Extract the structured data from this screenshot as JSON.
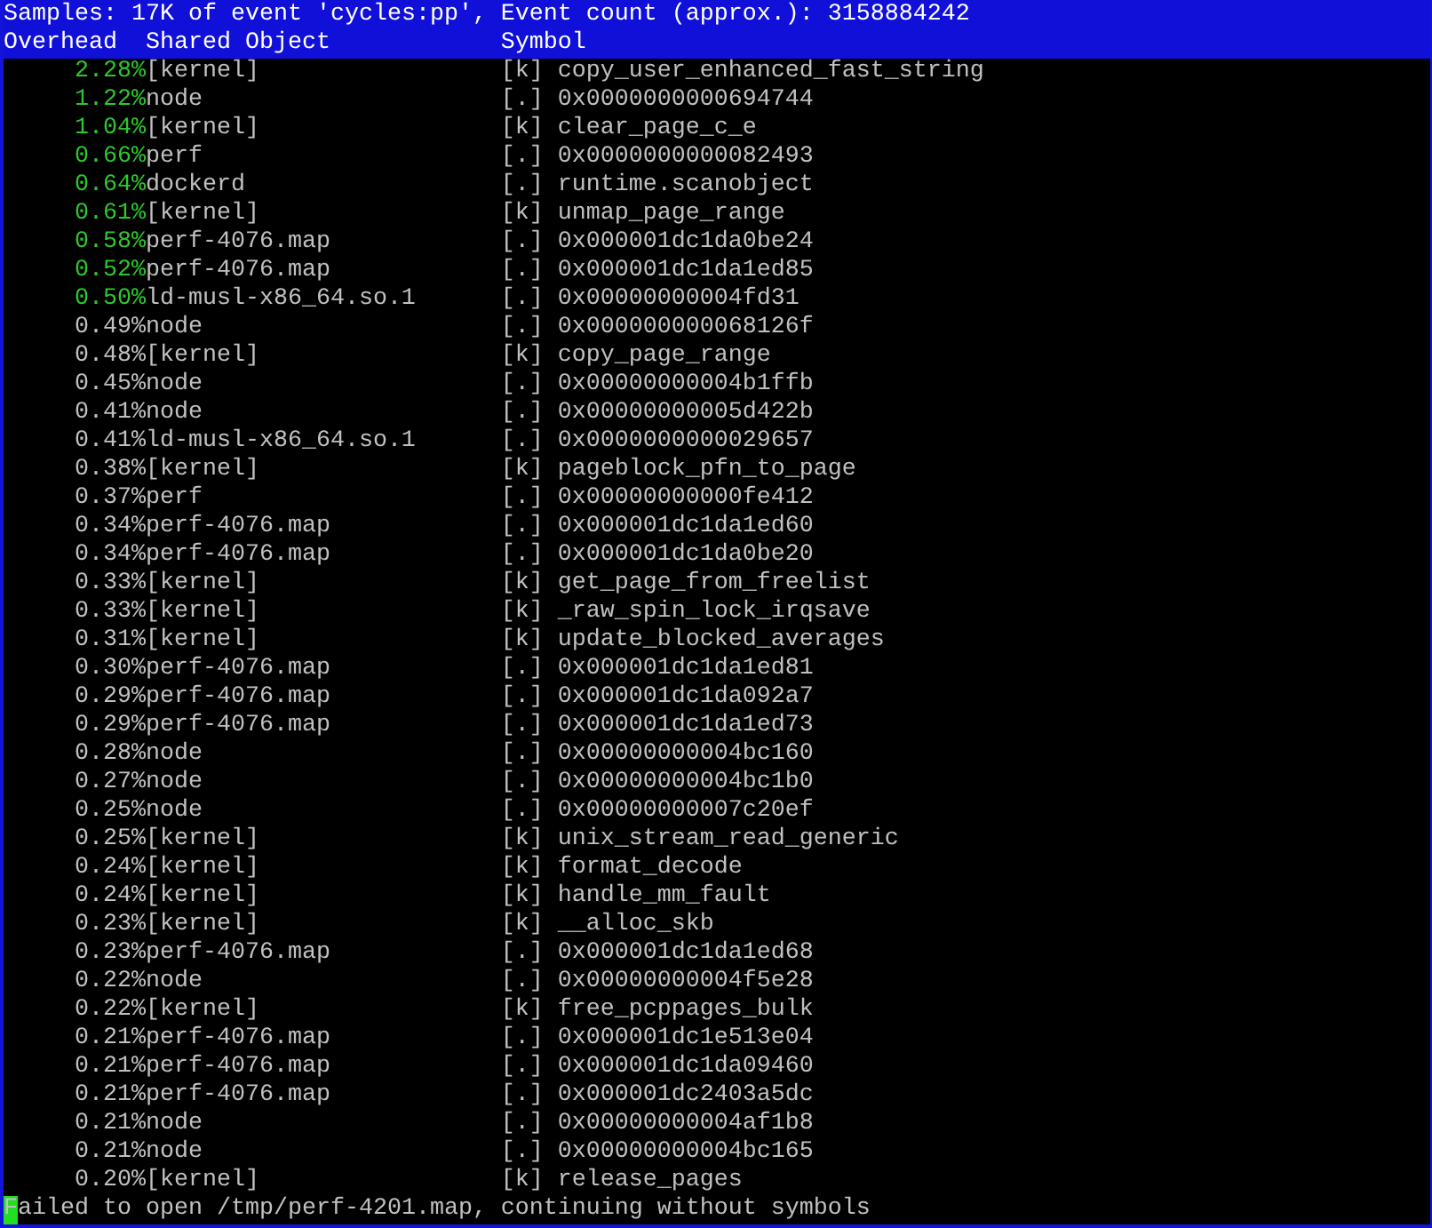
{
  "header": {
    "summary": "Samples: 17K of event 'cycles:pp', Event count (approx.): 3158884242"
  },
  "columns": [
    "Overhead",
    "Shared Object",
    "Symbol"
  ],
  "rows": [
    {
      "overhead": "2.28%",
      "hot": true,
      "object": "[kernel]",
      "tag": "[k]",
      "symbol": "copy_user_enhanced_fast_string"
    },
    {
      "overhead": "1.22%",
      "hot": true,
      "object": "node",
      "tag": "[.]",
      "symbol": "0x0000000000694744"
    },
    {
      "overhead": "1.04%",
      "hot": true,
      "object": "[kernel]",
      "tag": "[k]",
      "symbol": "clear_page_c_e"
    },
    {
      "overhead": "0.66%",
      "hot": true,
      "object": "perf",
      "tag": "[.]",
      "symbol": "0x0000000000082493"
    },
    {
      "overhead": "0.64%",
      "hot": true,
      "object": "dockerd",
      "tag": "[.]",
      "symbol": "runtime.scanobject"
    },
    {
      "overhead": "0.61%",
      "hot": true,
      "object": "[kernel]",
      "tag": "[k]",
      "symbol": "unmap_page_range"
    },
    {
      "overhead": "0.58%",
      "hot": true,
      "object": "perf-4076.map",
      "tag": "[.]",
      "symbol": "0x000001dc1da0be24"
    },
    {
      "overhead": "0.52%",
      "hot": true,
      "object": "perf-4076.map",
      "tag": "[.]",
      "symbol": "0x000001dc1da1ed85"
    },
    {
      "overhead": "0.50%",
      "hot": true,
      "object": "ld-musl-x86_64.so.1",
      "tag": "[.]",
      "symbol": "0x00000000004fd31"
    },
    {
      "overhead": "0.49%",
      "hot": false,
      "object": "node",
      "tag": "[.]",
      "symbol": "0x000000000068126f"
    },
    {
      "overhead": "0.48%",
      "hot": false,
      "object": "[kernel]",
      "tag": "[k]",
      "symbol": "copy_page_range"
    },
    {
      "overhead": "0.45%",
      "hot": false,
      "object": "node",
      "tag": "[.]",
      "symbol": "0x00000000004b1ffb"
    },
    {
      "overhead": "0.41%",
      "hot": false,
      "object": "node",
      "tag": "[.]",
      "symbol": "0x00000000005d422b"
    },
    {
      "overhead": "0.41%",
      "hot": false,
      "object": "ld-musl-x86_64.so.1",
      "tag": "[.]",
      "symbol": "0x0000000000029657"
    },
    {
      "overhead": "0.38%",
      "hot": false,
      "object": "[kernel]",
      "tag": "[k]",
      "symbol": "pageblock_pfn_to_page"
    },
    {
      "overhead": "0.37%",
      "hot": false,
      "object": "perf",
      "tag": "[.]",
      "symbol": "0x00000000000fe412"
    },
    {
      "overhead": "0.34%",
      "hot": false,
      "object": "perf-4076.map",
      "tag": "[.]",
      "symbol": "0x000001dc1da1ed60"
    },
    {
      "overhead": "0.34%",
      "hot": false,
      "object": "perf-4076.map",
      "tag": "[.]",
      "symbol": "0x000001dc1da0be20"
    },
    {
      "overhead": "0.33%",
      "hot": false,
      "object": "[kernel]",
      "tag": "[k]",
      "symbol": "get_page_from_freelist"
    },
    {
      "overhead": "0.33%",
      "hot": false,
      "object": "[kernel]",
      "tag": "[k]",
      "symbol": "_raw_spin_lock_irqsave"
    },
    {
      "overhead": "0.31%",
      "hot": false,
      "object": "[kernel]",
      "tag": "[k]",
      "symbol": "update_blocked_averages"
    },
    {
      "overhead": "0.30%",
      "hot": false,
      "object": "perf-4076.map",
      "tag": "[.]",
      "symbol": "0x000001dc1da1ed81"
    },
    {
      "overhead": "0.29%",
      "hot": false,
      "object": "perf-4076.map",
      "tag": "[.]",
      "symbol": "0x000001dc1da092a7"
    },
    {
      "overhead": "0.29%",
      "hot": false,
      "object": "perf-4076.map",
      "tag": "[.]",
      "symbol": "0x000001dc1da1ed73"
    },
    {
      "overhead": "0.28%",
      "hot": false,
      "object": "node",
      "tag": "[.]",
      "symbol": "0x00000000004bc160"
    },
    {
      "overhead": "0.27%",
      "hot": false,
      "object": "node",
      "tag": "[.]",
      "symbol": "0x00000000004bc1b0"
    },
    {
      "overhead": "0.25%",
      "hot": false,
      "object": "node",
      "tag": "[.]",
      "symbol": "0x00000000007c20ef"
    },
    {
      "overhead": "0.25%",
      "hot": false,
      "object": "[kernel]",
      "tag": "[k]",
      "symbol": "unix_stream_read_generic"
    },
    {
      "overhead": "0.24%",
      "hot": false,
      "object": "[kernel]",
      "tag": "[k]",
      "symbol": "format_decode"
    },
    {
      "overhead": "0.24%",
      "hot": false,
      "object": "[kernel]",
      "tag": "[k]",
      "symbol": "handle_mm_fault"
    },
    {
      "overhead": "0.23%",
      "hot": false,
      "object": "[kernel]",
      "tag": "[k]",
      "symbol": "__alloc_skb"
    },
    {
      "overhead": "0.23%",
      "hot": false,
      "object": "perf-4076.map",
      "tag": "[.]",
      "symbol": "0x000001dc1da1ed68"
    },
    {
      "overhead": "0.22%",
      "hot": false,
      "object": "node",
      "tag": "[.]",
      "symbol": "0x00000000004f5e28"
    },
    {
      "overhead": "0.22%",
      "hot": false,
      "object": "[kernel]",
      "tag": "[k]",
      "symbol": "free_pcppages_bulk"
    },
    {
      "overhead": "0.21%",
      "hot": false,
      "object": "perf-4076.map",
      "tag": "[.]",
      "symbol": "0x000001dc1e513e04"
    },
    {
      "overhead": "0.21%",
      "hot": false,
      "object": "perf-4076.map",
      "tag": "[.]",
      "symbol": "0x000001dc1da09460"
    },
    {
      "overhead": "0.21%",
      "hot": false,
      "object": "perf-4076.map",
      "tag": "[.]",
      "symbol": "0x000001dc2403a5dc"
    },
    {
      "overhead": "0.21%",
      "hot": false,
      "object": "node",
      "tag": "[.]",
      "symbol": "0x00000000004af1b8"
    },
    {
      "overhead": "0.21%",
      "hot": false,
      "object": "node",
      "tag": "[.]",
      "symbol": "0x00000000004bc165"
    },
    {
      "overhead": "0.20%",
      "hot": false,
      "object": "[kernel]",
      "tag": "[k]",
      "symbol": "release_pages"
    }
  ],
  "status_line": {
    "text": "Failed to open /tmp/perf-4201.map, continuing without symbols",
    "cursor": true
  }
}
